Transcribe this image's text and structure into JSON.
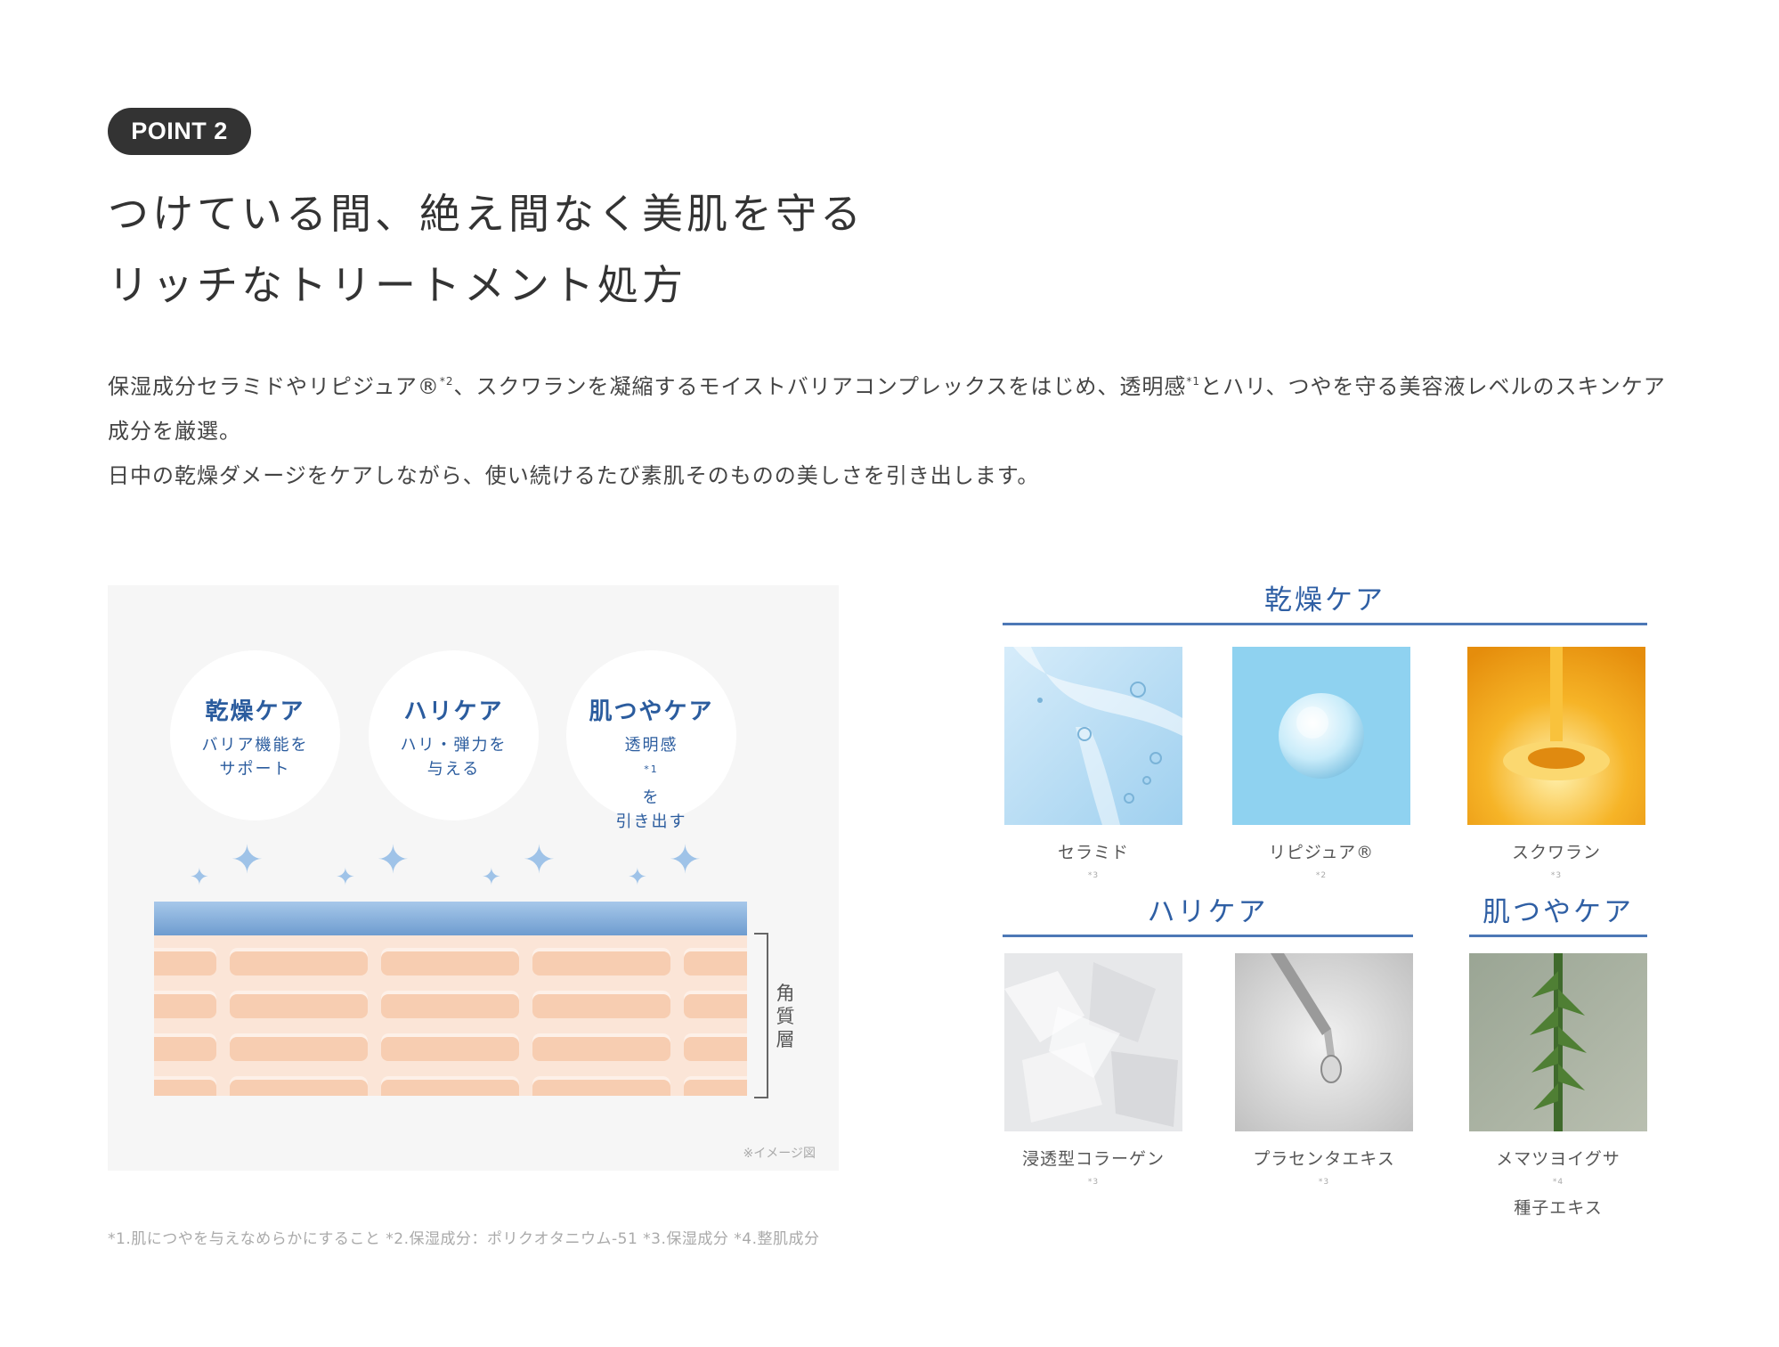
{
  "point_badge": "POINT 2",
  "headline": {
    "line1": "つけている間、絶え間なく美肌を守る",
    "line2": "リッチなトリートメント処方"
  },
  "body": {
    "p1_part1": "保湿成分セラミドやリピジュア®",
    "p1_sup1": "*2",
    "p1_part2": "、スクワランを凝縮するモイストバリアコンプレックスをはじめ、透明感",
    "p1_sup2": "*1",
    "p1_part3": "とハリ、つやを守る美容液レベルのスキンケア成分を厳選。",
    "p2": "日中の乾燥ダメージをケアしながら、使い続けるたび素肌そのものの美しさを引き出します。"
  },
  "diagram": {
    "circles": [
      {
        "title": "乾燥ケア",
        "line1": "バリア機能を",
        "line2": "サポート"
      },
      {
        "title": "ハリケア",
        "line1": "ハリ・弾力を",
        "line2": "与える"
      },
      {
        "title": "肌つやケア",
        "line1_a": "透明感",
        "line1_sup": "*1",
        "line1_b": "を",
        "line2": "引き出す"
      }
    ],
    "layer_label": [
      "角",
      "質",
      "層"
    ],
    "image_note": "※イメージ図"
  },
  "categories": {
    "dry": "乾燥ケア",
    "firm": "ハリケア",
    "glow": "肌つやケア"
  },
  "ingredients": [
    {
      "name": "セラミド",
      "sup": "*3"
    },
    {
      "name": "リピジュア®",
      "sup": "*2"
    },
    {
      "name": "スクワラン",
      "sup": "*3"
    },
    {
      "name": "浸透型コラーゲン",
      "sup": "*3"
    },
    {
      "name": "プラセンタエキス",
      "sup": "*3"
    },
    {
      "name": "メマツヨイグサ",
      "sup": "*4",
      "name2": "種子エキス"
    }
  ],
  "footnote": "*1.肌につやを与えなめらかにすること *2.保湿成分：ポリクオタニウム-51 *3.保湿成分 *4.整肌成分",
  "colors": {
    "accent_blue": "#2f5fa4",
    "badge_bg": "#333333"
  }
}
